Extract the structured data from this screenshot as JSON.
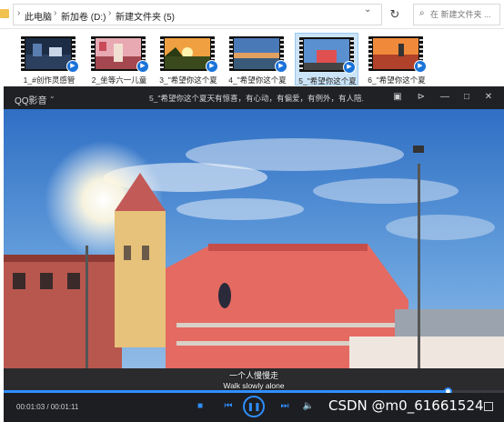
{
  "explorer": {
    "breadcrumb": [
      "此电脑",
      "新加卷 (D:)",
      "新建文件夹 (5)"
    ],
    "search_placeholder": "在 新建文件夹 ..."
  },
  "thumbnails": [
    {
      "label": "1_#创作灵感管",
      "selected": false
    },
    {
      "label": "2_坐等六一儿童",
      "selected": false
    },
    {
      "label": "3_\"希望你这个夏",
      "selected": false
    },
    {
      "label": "4_\"希望你这个夏",
      "selected": false
    },
    {
      "label": "5_\"希望你这个夏",
      "selected": true
    },
    {
      "label": "6_\"希望你这个夏",
      "selected": false
    }
  ],
  "player": {
    "app_name": "QQ影音",
    "title": "5_\"希望你这个夏天有惊喜，有心动，有偏爱，有例外，有人陪...",
    "subtitle_cn": "一个人慢慢走",
    "subtitle_en": "Walk slowly alone",
    "time": "00:01:03 / 00:01:11",
    "progress_fraction": 0.887,
    "watermark": "CSDN @m0_61661524"
  }
}
